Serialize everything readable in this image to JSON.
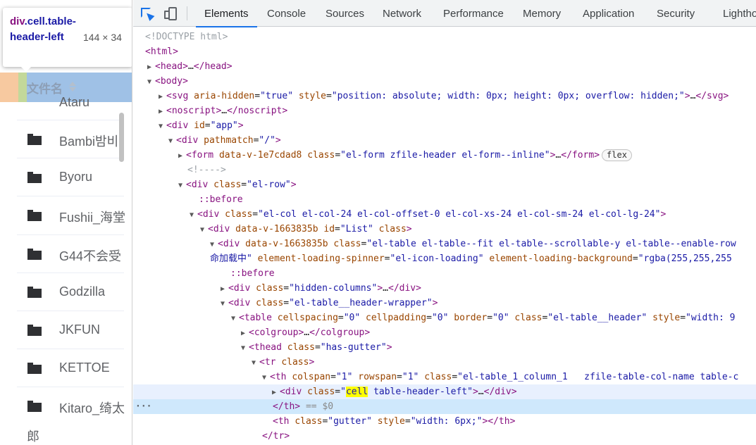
{
  "tooltip": {
    "element_tag": "div",
    "element_class_text": ".cell.table-header-left",
    "size": "144 × 34"
  },
  "page": {
    "column_header": "文件名",
    "files": [
      "Bambi밤비",
      "Byoru",
      "Fushii_海堂",
      "G44不会受",
      "Godzilla",
      "JKFUN",
      "KETTOE",
      "Kitaro_绮太"
    ],
    "wrap_text": "郎",
    "partial_top_text": "Ataru"
  },
  "devtools": {
    "tabs": [
      "Elements",
      "Console",
      "Sources",
      "Network",
      "Performance",
      "Memory",
      "Application",
      "Security",
      "Lighthouse"
    ],
    "active_tab": "Elements",
    "selected_marker": "== $0",
    "hover_dots": "···"
  },
  "colors": {
    "accent": "#1a73e8",
    "tag": "#881280",
    "attr_name": "#994500",
    "attr_value": "#1a1aa6",
    "selection": "#cfe8fc"
  }
}
